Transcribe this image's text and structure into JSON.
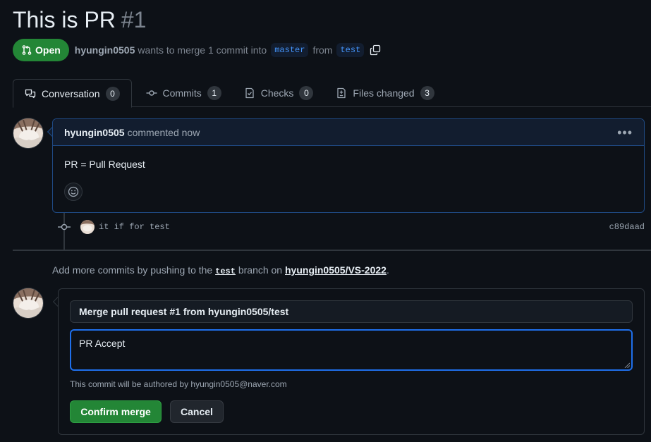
{
  "pr": {
    "title": "This is PR",
    "number": "#1",
    "state": "Open",
    "author": "hyungin0505",
    "summary_text": "wants to merge 1 commit into",
    "base_branch": "master",
    "from_text": "from",
    "head_branch": "test"
  },
  "tabs": [
    {
      "label": "Conversation",
      "count": "0",
      "icon": "conversation-icon"
    },
    {
      "label": "Commits",
      "count": "1",
      "icon": "commit-icon"
    },
    {
      "label": "Checks",
      "count": "0",
      "icon": "checks-icon"
    },
    {
      "label": "Files changed",
      "count": "3",
      "icon": "file-diff-icon"
    }
  ],
  "comment": {
    "author": "hyungin0505",
    "meta": "commented now",
    "menu": "•••",
    "body": "PR = Pull Request"
  },
  "commit": {
    "message": "it if for test",
    "sha": "c89daad"
  },
  "hint": {
    "prefix": "Add more commits by pushing to the",
    "branch": "test",
    "middle": "branch on",
    "repo": "hyungin0505/VS-2022",
    "suffix": "."
  },
  "merge": {
    "title_value": "Merge pull request #1 from hyungin0505/test",
    "message_value": "PR Accept",
    "authored_note": "This commit will be authored by hyungin0505@naver.com",
    "confirm_label": "Confirm merge",
    "cancel_label": "Cancel"
  },
  "colors": {
    "background": "#0d1117",
    "open_green": "#238636",
    "accent_blue": "#1f6feb",
    "border": "#30363d"
  }
}
